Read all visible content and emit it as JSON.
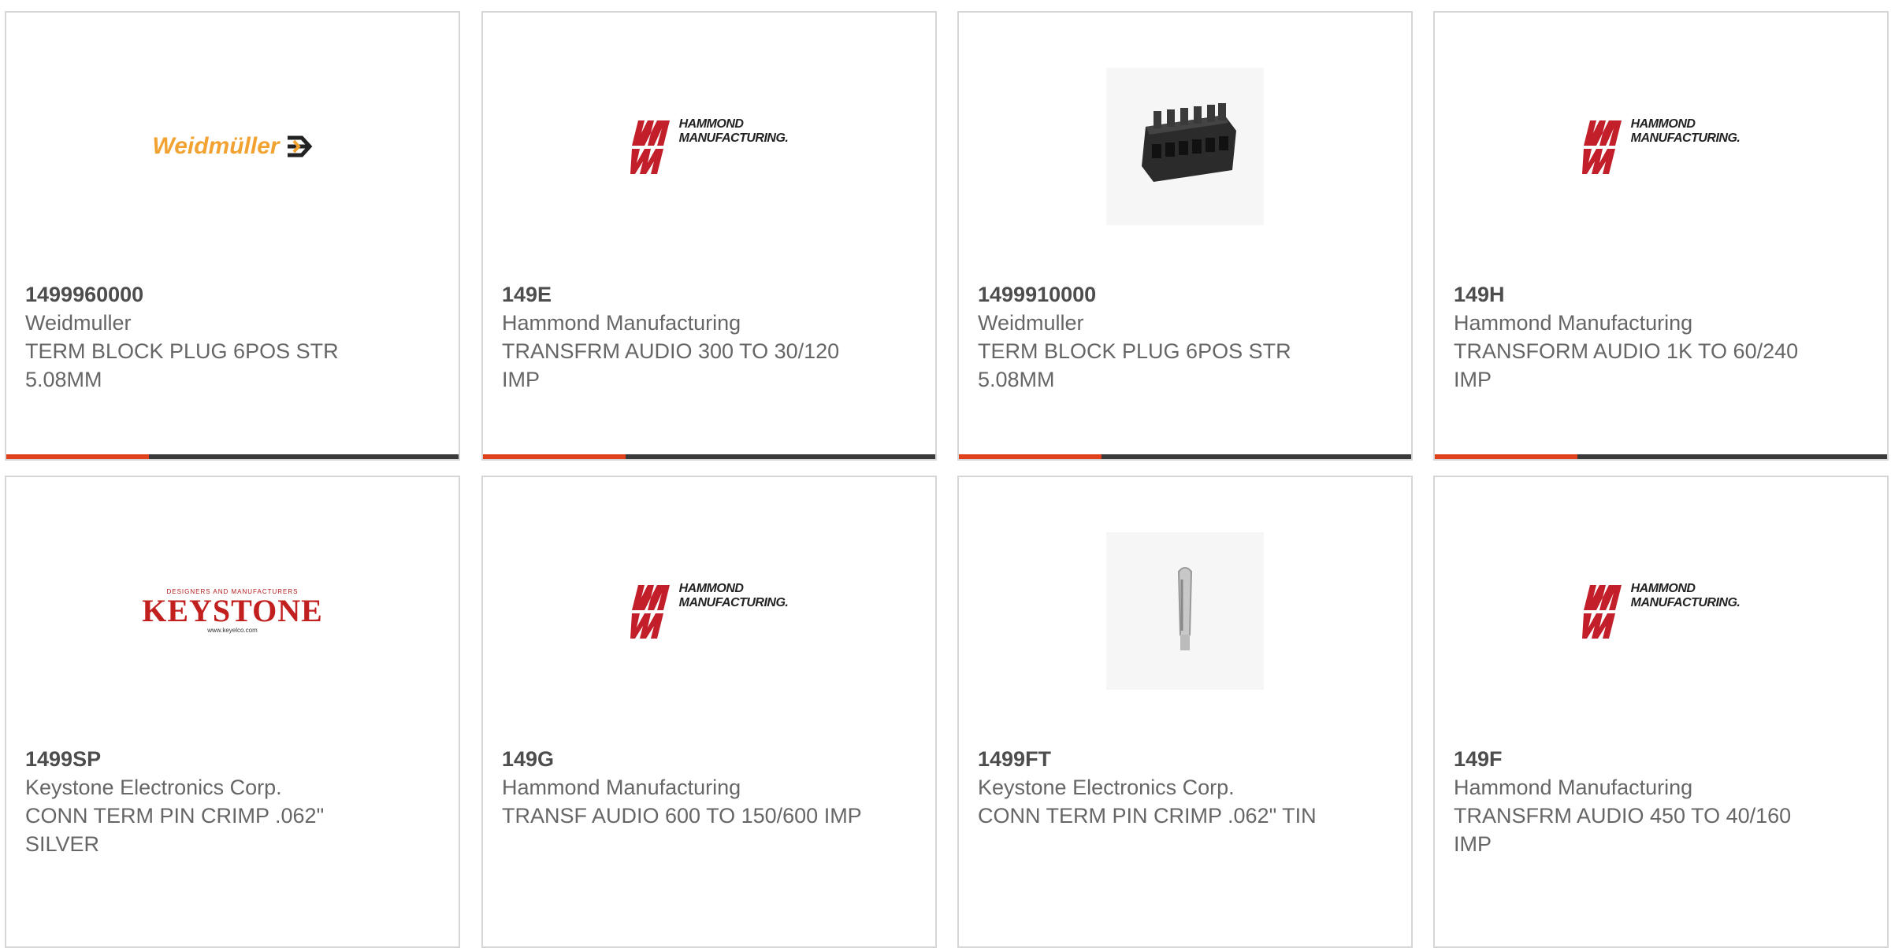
{
  "products": [
    {
      "part_number": "1499960000",
      "manufacturer": "Weidmuller",
      "description": "TERM BLOCK PLUG 6POS STR 5.08MM",
      "image": "weidmuller-logo",
      "logo_text": "Weidmüller"
    },
    {
      "part_number": "149E",
      "manufacturer": "Hammond Manufacturing",
      "description": "TRANSFRM AUDIO 300 TO 30/120 IMP",
      "image": "hammond-logo",
      "logo_text": [
        "HAMMOND",
        "MANUFACTURING."
      ]
    },
    {
      "part_number": "1499910000",
      "manufacturer": "Weidmuller",
      "description": "TERM BLOCK PLUG 6POS STR 5.08MM",
      "image": "terminal-block-photo"
    },
    {
      "part_number": "149H",
      "manufacturer": "Hammond Manufacturing",
      "description": "TRANSFORM AUDIO 1K TO 60/240 IMP",
      "image": "hammond-logo",
      "logo_text": [
        "HAMMOND",
        "MANUFACTURING."
      ]
    },
    {
      "part_number": "1499SP",
      "manufacturer": "Keystone Electronics Corp.",
      "description": "CONN TERM PIN CRIMP .062\" SILVER",
      "image": "keystone-logo",
      "logo_text": [
        "DESIGNERS AND MANUFACTURERS",
        "KEYSTONE",
        "www.keyelco.com"
      ]
    },
    {
      "part_number": "149G",
      "manufacturer": "Hammond Manufacturing",
      "description": "TRANSF AUDIO 600 TO 150/600 IMP",
      "image": "hammond-logo",
      "logo_text": [
        "HAMMOND",
        "MANUFACTURING."
      ]
    },
    {
      "part_number": "1499FT",
      "manufacturer": "Keystone Electronics Corp.",
      "description": "CONN TERM PIN CRIMP .062\" TIN",
      "image": "crimp-pin-photo"
    },
    {
      "part_number": "149F",
      "manufacturer": "Hammond Manufacturing",
      "description": "TRANSFRM AUDIO 450 TO 40/160 IMP",
      "image": "hammond-logo",
      "logo_text": [
        "HAMMOND",
        "MANUFACTURING."
      ]
    }
  ],
  "colors": {
    "accent": "#e0401c",
    "bar_dark": "#3a3a3a",
    "card_border": "#d6d6d6",
    "weidmuller_orange": "#f2a230",
    "hammond_red": "#c21f2a",
    "keystone_red": "#c21f1f"
  }
}
